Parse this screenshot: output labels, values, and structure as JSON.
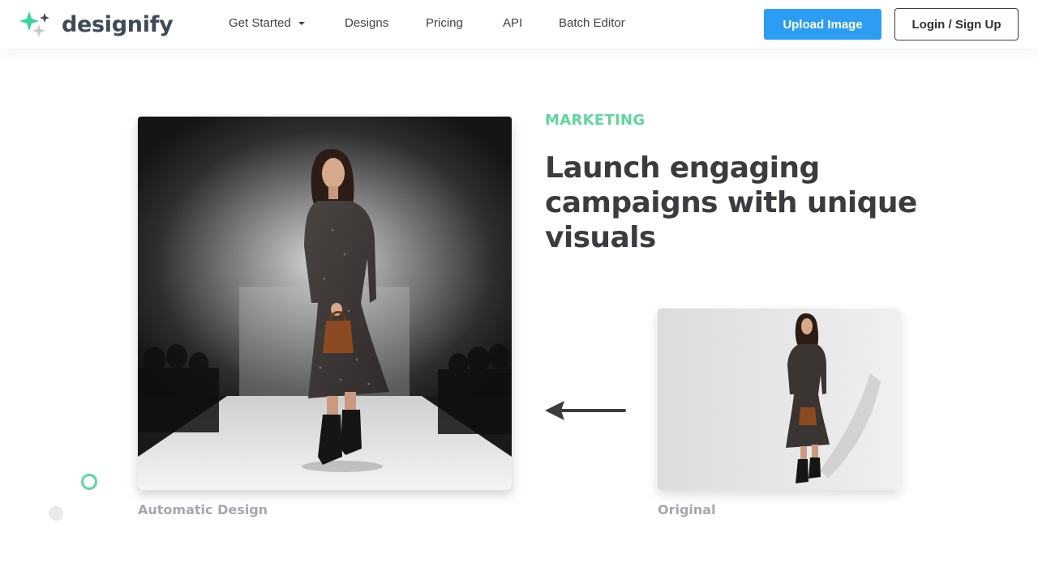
{
  "header": {
    "brand": "designify",
    "nav": [
      {
        "label": "Get Started",
        "has_dropdown": true
      },
      {
        "label": "Designs"
      },
      {
        "label": "Pricing"
      },
      {
        "label": "API"
      },
      {
        "label": "Batch Editor"
      }
    ],
    "upload_label": "Upload Image",
    "login_label": "Login / Sign Up"
  },
  "main": {
    "eyebrow": "MARKETING",
    "headline": "Launch engaging campaigns with unique visuals",
    "result_caption": "Automatic Design",
    "original_caption": "Original"
  },
  "colors": {
    "accent_green": "#5fd6a0",
    "primary_blue": "#2c9df3",
    "text_dark": "#3a3c3f",
    "caption_gray": "#a4a8ad"
  },
  "icons": {
    "logo": "sparkle-stars-icon",
    "dropdown": "caret-down-icon",
    "arrow": "arrow-left-icon"
  }
}
